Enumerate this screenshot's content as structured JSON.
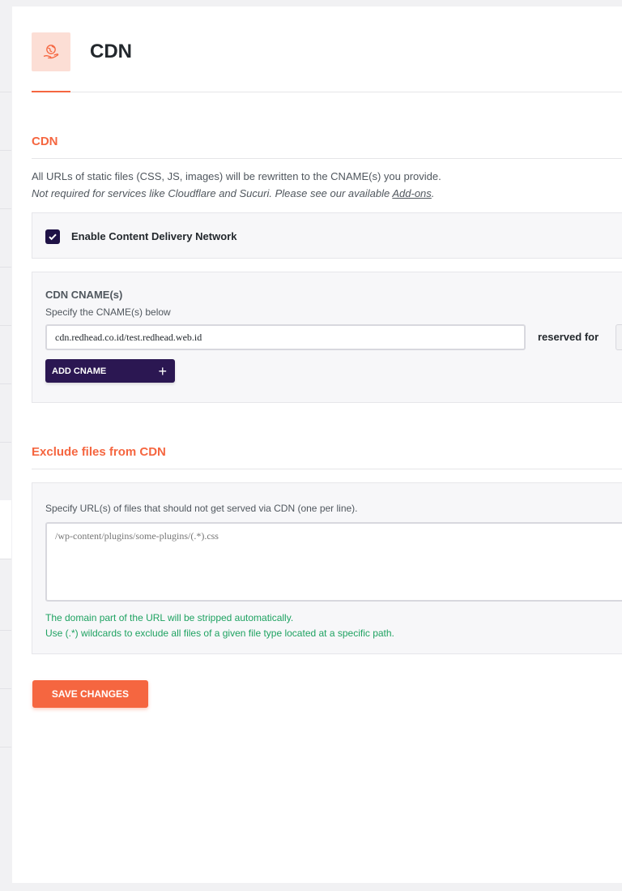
{
  "header": {
    "title": "CDN",
    "icon": "globe-hand-icon"
  },
  "cdn_section": {
    "title": "CDN",
    "description_line1": "All URLs of static files (CSS, JS, images) will be rewritten to the CNAME(s) you provide.",
    "description_line2_prefix": "Not required for services like Cloudflare and Sucuri. Please see our available ",
    "description_link": "Add-ons",
    "description_line2_suffix": ".",
    "enable_label": "Enable Content Delivery Network",
    "enable_checked": true,
    "cname_title": "CDN CNAME(s)",
    "cname_subtitle": "Specify the CNAME(s) below",
    "cname_value": "cdn.redhead.co.id/test.redhead.web.id",
    "reserved_label": "reserved for",
    "add_cname_label": "ADD CNAME",
    "add_cname_icon": "+"
  },
  "exclude_section": {
    "title": "Exclude files from CDN",
    "field_label": "Specify URL(s) of files that should not get served via CDN (one per line).",
    "placeholder": "/wp-content/plugins/some-plugins/(.*).css",
    "helper_line1": "The domain part of the URL will be stripped automatically.",
    "helper_line2": "Use (.*) wildcards to exclude all files of a given file type located at a specific path."
  },
  "save_label": "SAVE CHANGES",
  "colors": {
    "accent": "#f56640",
    "primary_dark": "#2b1752",
    "helper_green": "#1ea261",
    "icon_bg": "#fcded5"
  }
}
